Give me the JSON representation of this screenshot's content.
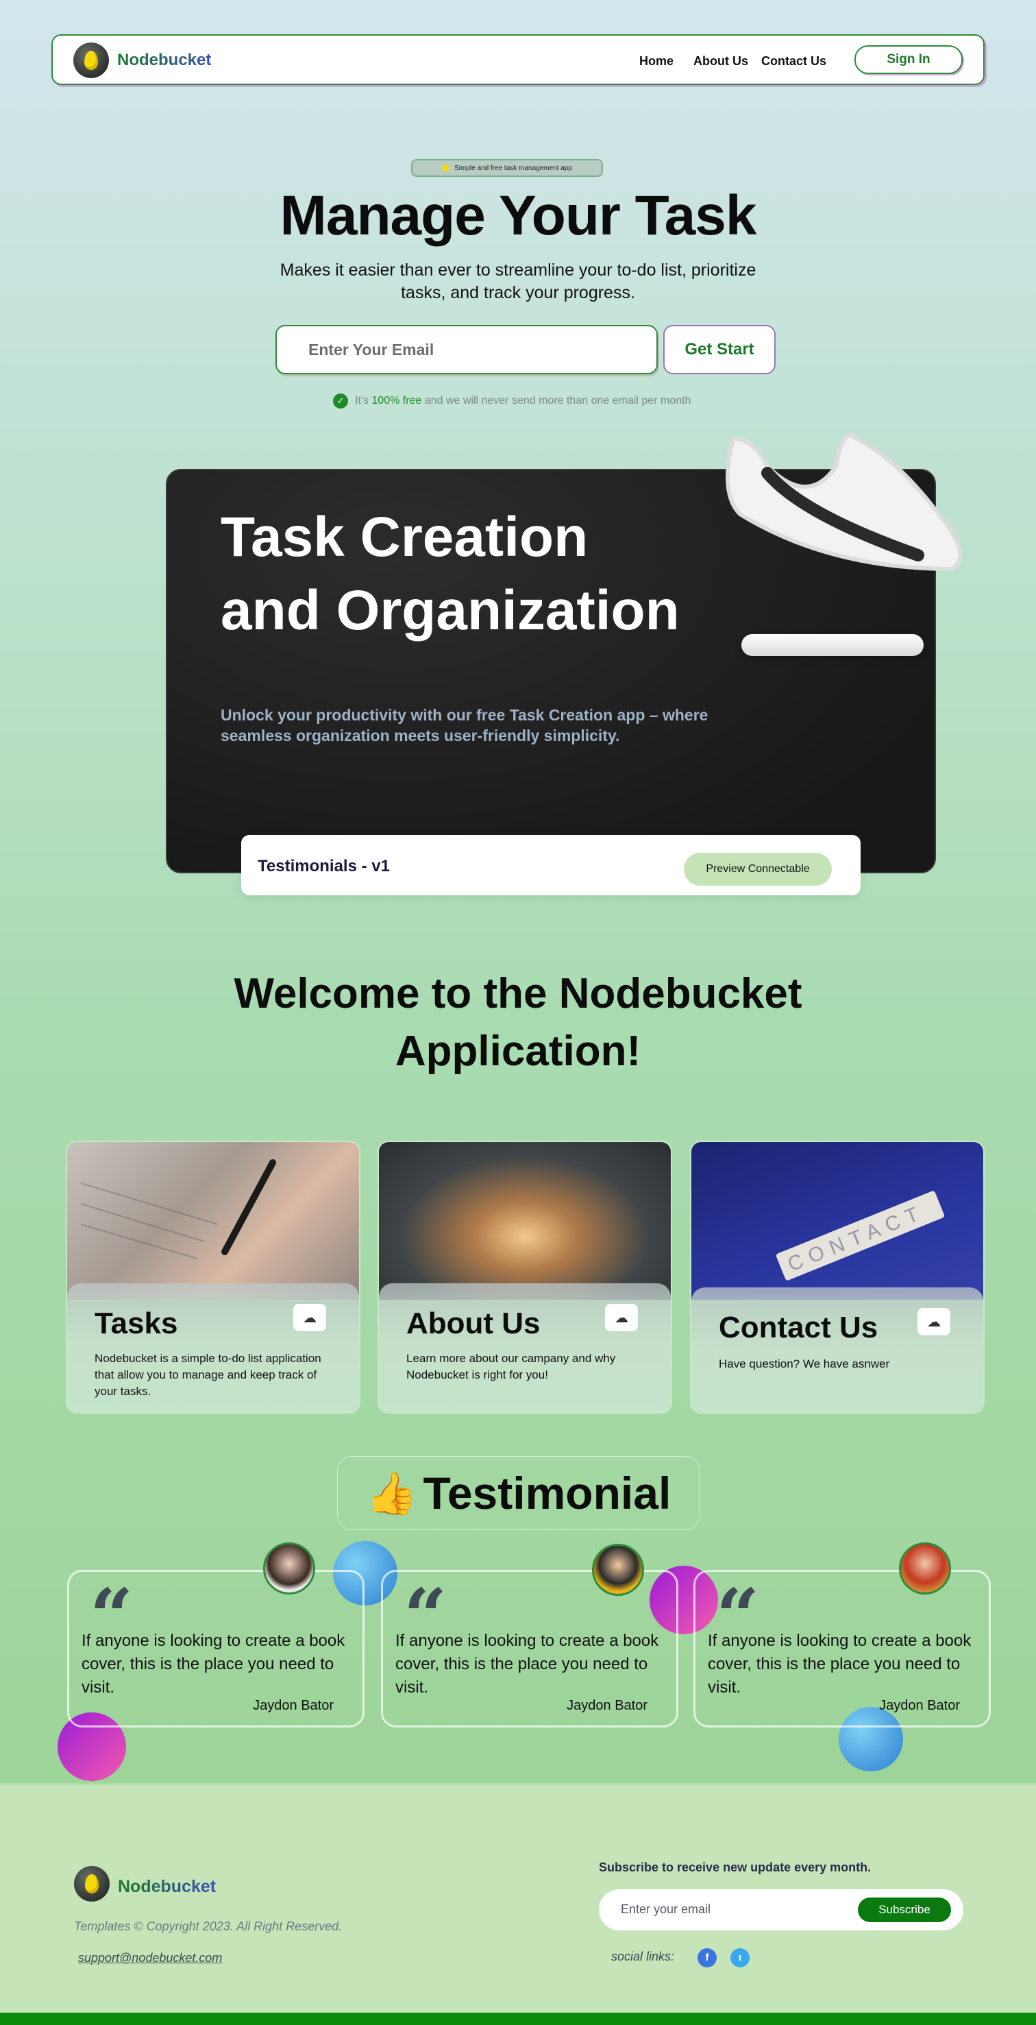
{
  "nav": {
    "brand": "Nodebucket",
    "links": [
      "Home",
      "About Us",
      "Contact Us"
    ],
    "signin": "Sign In"
  },
  "hero": {
    "pill": "Simple and free task management app",
    "title": "Manage Your Task",
    "subtitle": "Makes it easier than ever to streamline your to-do list, prioritize tasks, and track your progress.",
    "email_placeholder": "Enter Your Email",
    "cta": "Get Start",
    "note_prefix": "It's ",
    "note_highlight": "100% free",
    "note_suffix": " and we will never send more than one email per month"
  },
  "showcase": {
    "title_line1": "Task Creation",
    "title_line2": "and Organization",
    "subtitle": "Unlock your productivity with our free Task Creation app – where seamless organization meets user-friendly simplicity.",
    "bar_label": "Testimonials - v1",
    "preview_button": "Preview Connectable"
  },
  "welcome": {
    "line1": "Welcome to the Nodebucket",
    "line2": "Application!"
  },
  "features": [
    {
      "title": "Tasks",
      "desc": "Nodebucket is a simple to-do list application that allow you to manage and keep track of your tasks."
    },
    {
      "title": "About Us",
      "desc": "Learn more about our campany and why Nodebucket is right for you!"
    },
    {
      "title": "Contact Us",
      "desc": "Have question? We have asnwer"
    }
  ],
  "feature_image_text": "CONTACT",
  "testimonial": {
    "heading": "Testimonial",
    "items": [
      {
        "quote": "If anyone is looking to create a book cover, this is the place you need to visit.",
        "author": "Jaydon Bator"
      },
      {
        "quote": "If anyone is looking to create a book cover, this is the place you need to visit.",
        "author": "Jaydon Bator"
      },
      {
        "quote": "If anyone is looking to create a book cover, this is the place you need to visit.",
        "author": "Jaydon Bator"
      }
    ]
  },
  "footer": {
    "brand": "Nodebucket",
    "copyright": "Templates © Copyright 2023. All Right Reserved.",
    "support": "support@nodebucket.com",
    "subscribe_label": "Subscribe to receive new update every month.",
    "subscribe_placeholder": "Enter your email",
    "subscribe_button": "Subscribe",
    "social_label": "social links:",
    "social_icons": [
      "facebook-icon",
      "twitter-icon"
    ]
  },
  "colors": {
    "brand_green": "#1e7a2c",
    "accent_purple": "#9a7ab5",
    "footer_bar": "#0a8a0a"
  }
}
